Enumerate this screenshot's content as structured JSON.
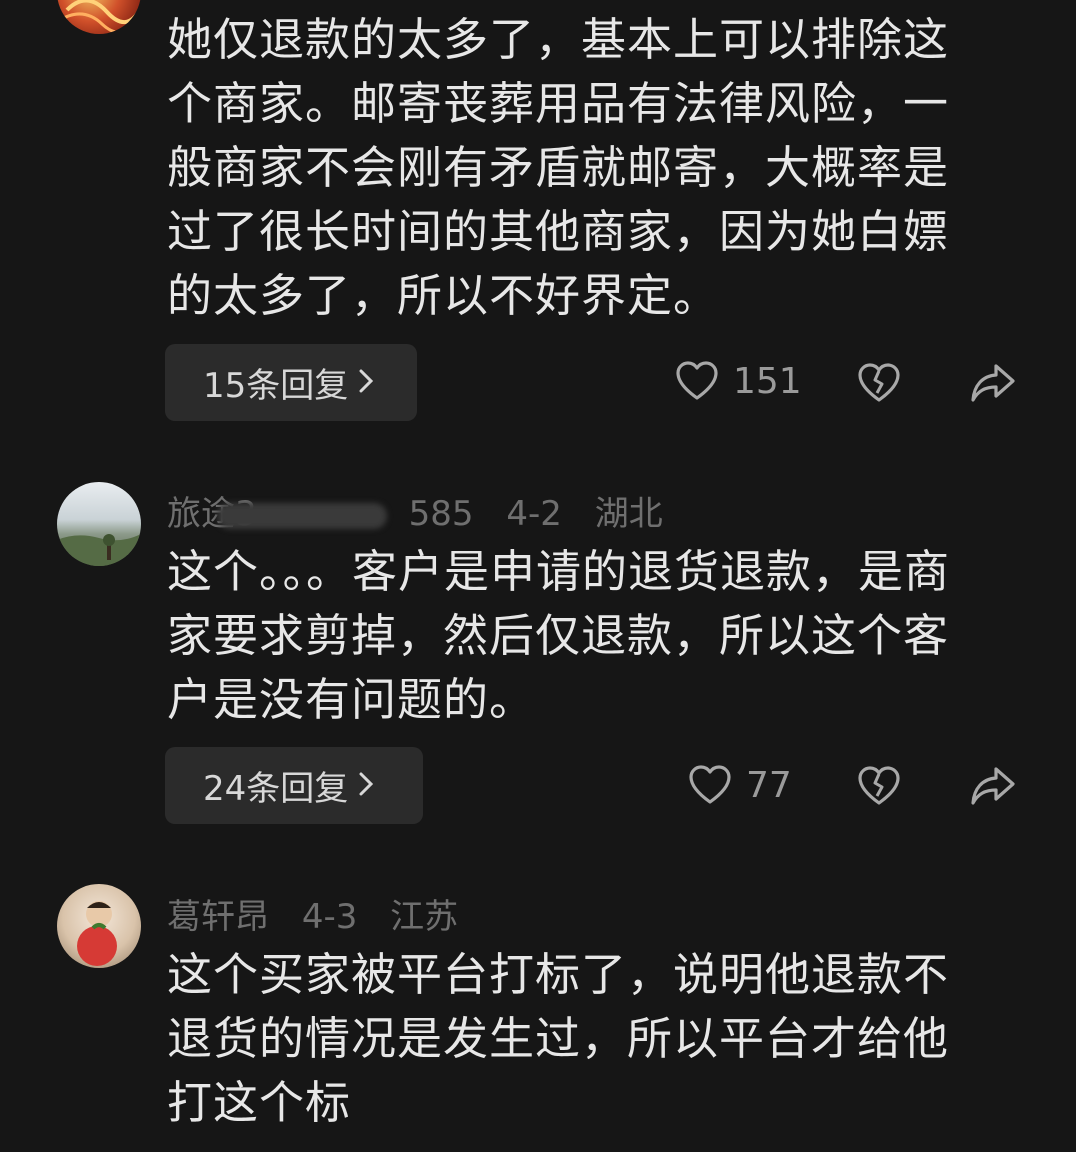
{
  "comments": [
    {
      "text": "她仅退款的太多了，基本上可以排除这个商家。邮寄丧葬用品有法律风险，一般商家不会刚有矛盾就邮寄，大概率是过了很长时间的其他商家，因为她白嫖的太多了，所以不好界定。",
      "replies_label": "15条回复",
      "likes": "151"
    },
    {
      "username_prefix": "旅途3",
      "username_suffix": "585",
      "date": "4-2",
      "location": "湖北",
      "text": "这个。。。客户是申请的退货退款，是商家要求剪掉，然后仅退款，所以这个客户是没有问题的。",
      "replies_label": "24条回复",
      "likes": "77"
    },
    {
      "username": "葛轩昂",
      "date": "4-3",
      "location": "江苏",
      "text": "这个买家被平台打标了，说明他退款不退货的情况是发生过，所以平台才给他打这个标"
    }
  ],
  "icons": {
    "like": "heart-outline-icon",
    "dislike": "broken-heart-icon",
    "share": "share-arrow-icon",
    "chevron": "chevron-right-icon"
  },
  "colors": {
    "background": "#161616",
    "text": "#e7e7e7",
    "meta": "#6f6f6f",
    "reply_button": "#2b2b2b"
  }
}
